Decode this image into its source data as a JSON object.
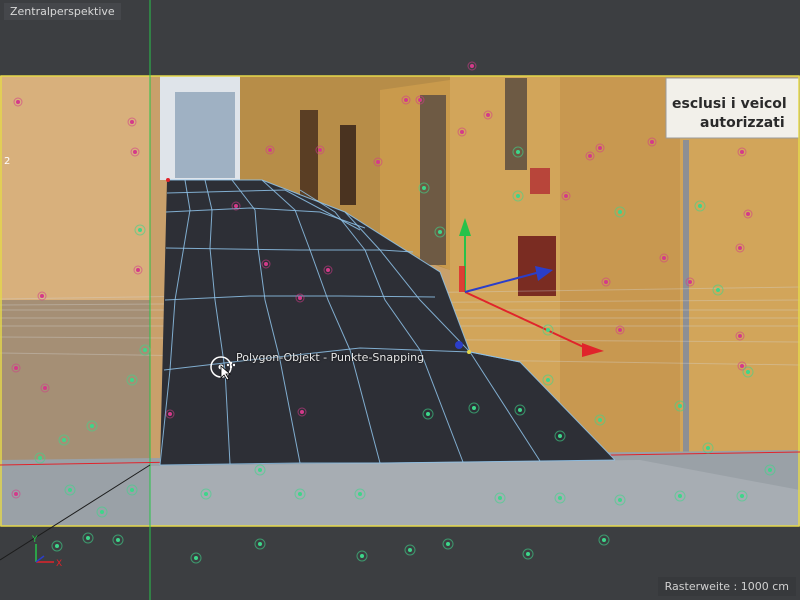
{
  "viewport": {
    "view_name": "Zentralperspektive",
    "grid_spacing_text": "Rasterweite : 1000 cm"
  },
  "snapping_tooltip": "Polygon-Objekt - Punkte-Snapping",
  "scene_text": {
    "sign_line1": "esclusi i veicol",
    "sign_line2": "autorizzati",
    "house_number": "2"
  },
  "axis_labels": {
    "y": "Y",
    "x": "X"
  },
  "colors": {
    "frame": "#e5d84a",
    "mesh_fill": "#2d2f36",
    "mesh_lines": "#8fc3ea",
    "axis_x": "#e0242b",
    "axis_y": "#27c24a",
    "axis_z": "#2b3ec9",
    "magenta_points": "#d43a8a",
    "green_points": "#3dd68a"
  },
  "icons": [
    "mouse-cursor-icon",
    "snapping-target-icon",
    "axis-triad-icon",
    "move-gizmo-icon"
  ]
}
